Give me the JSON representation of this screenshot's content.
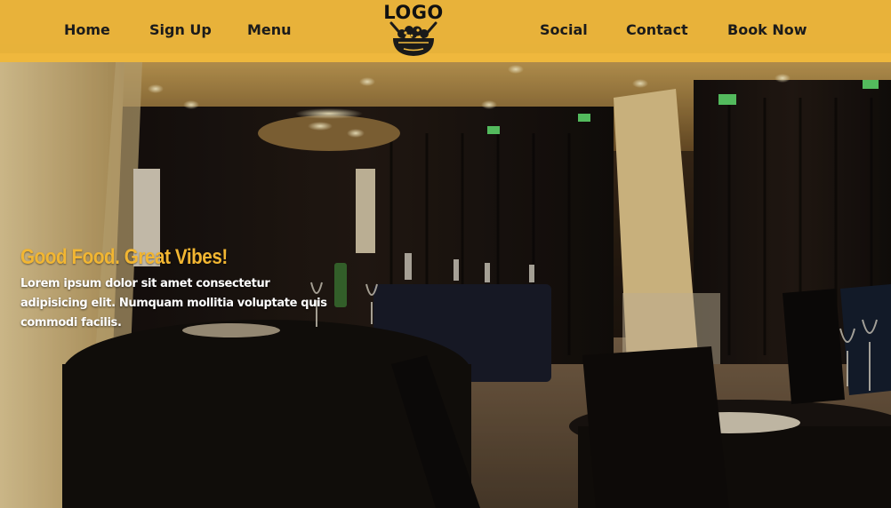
{
  "nav": {
    "left": [
      {
        "label": "Home"
      },
      {
        "label": "Sign Up"
      },
      {
        "label": "Menu"
      }
    ],
    "logo_text": "LOGO",
    "right": [
      {
        "label": "Social"
      },
      {
        "label": "Contact"
      },
      {
        "label": "Book Now"
      }
    ]
  },
  "hero": {
    "tagline": "Good Food. Great Vibes!",
    "blurb": "Lorem ipsum dolor sit amet consectetur adipisicing elit. Numquam mollitia voluptate quis commodi facilis."
  },
  "colors": {
    "header_bg": "#f3bb3c",
    "nav_text": "#1b1b1b",
    "tagline": "#f2b632",
    "blurb": "#ffffff"
  },
  "icons": {
    "logo": "salad-bowl-icon"
  }
}
